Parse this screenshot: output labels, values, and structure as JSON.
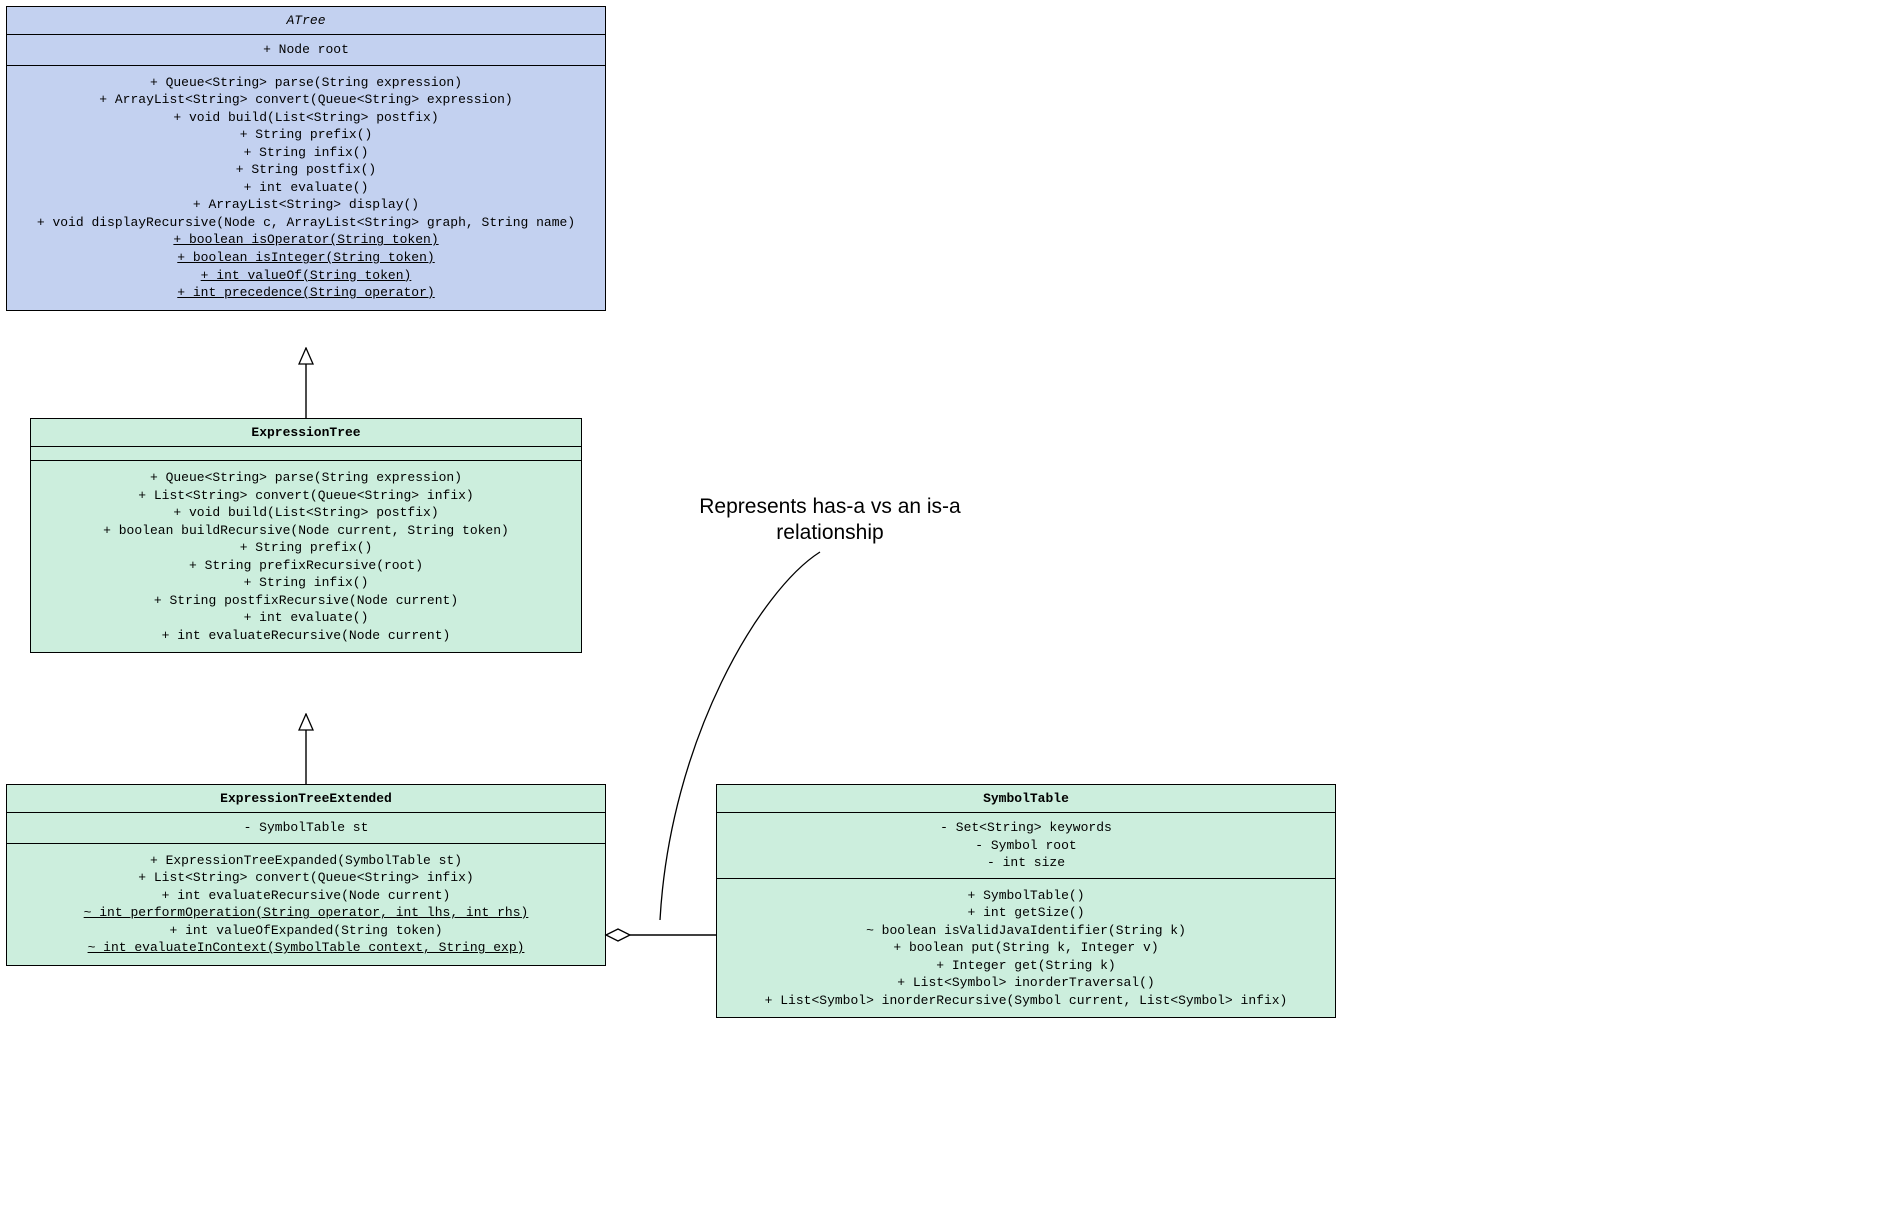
{
  "atree": {
    "title": "ATree",
    "attr1": "+ Node root",
    "op1": "+ Queue<String> parse(String expression)",
    "op2": "+ ArrayList<String> convert(Queue<String> expression)",
    "op3": "+ void build(List<String> postfix)",
    "op4": "+ String prefix()",
    "op5": "+ String infix()",
    "op6": "+ String postfix()",
    "op7": "+ int evaluate()",
    "op8": "+ ArrayList<String> display()",
    "op9": "+ void displayRecursive(Node c, ArrayList<String> graph, String name)",
    "op10": "+ boolean isOperator(String token)",
    "op11": "+ boolean isInteger(String token)",
    "op12": "+ int valueOf(String token)",
    "op13": "+ int precedence(String operator)"
  },
  "etree": {
    "title": "ExpressionTree",
    "op1": "+ Queue<String> parse(String expression)",
    "op2": "+ List<String> convert(Queue<String> infix)",
    "op3": "+ void build(List<String> postfix)",
    "op4": "+ boolean buildRecursive(Node current, String token)",
    "op5": "+ String prefix()",
    "op6": "+ String prefixRecursive(root)",
    "op7": "+ String infix()",
    "op8": "+ String postfixRecursive(Node current)",
    "op9": "+ int evaluate()",
    "op10": "+ int evaluateRecursive(Node current)"
  },
  "etree_ext": {
    "title": "ExpressionTreeExtended",
    "attr1": "- SymbolTable st",
    "op1": "+ ExpressionTreeExpanded(SymbolTable st)",
    "op2": "+ List<String> convert(Queue<String> infix)",
    "op3": "+ int evaluateRecursive(Node current)",
    "op4": "~ int performOperation(String operator, int lhs, int rhs)",
    "op5": "+ int valueOfExpanded(String token)",
    "op6": "~ int evaluateInContext(SymbolTable context, String exp)"
  },
  "symtab": {
    "title": "SymbolTable",
    "attr1": "- Set<String> keywords",
    "attr2": "- Symbol root",
    "attr3": "- int size",
    "op1": "+ SymbolTable()",
    "op2": "+ int getSize()",
    "op3": "~ boolean isValidJavaIdentifier(String k)",
    "op4": "+ boolean put(String k, Integer v)",
    "op5": "+ Integer get(String k)",
    "op6": "+ List<Symbol> inorderTraversal()",
    "op7": "+ List<Symbol> inorderRecursive(Symbol current, List<Symbol> infix)"
  },
  "annotation": {
    "line1": "Represents has-a vs an is-a",
    "line2": "relationship"
  }
}
